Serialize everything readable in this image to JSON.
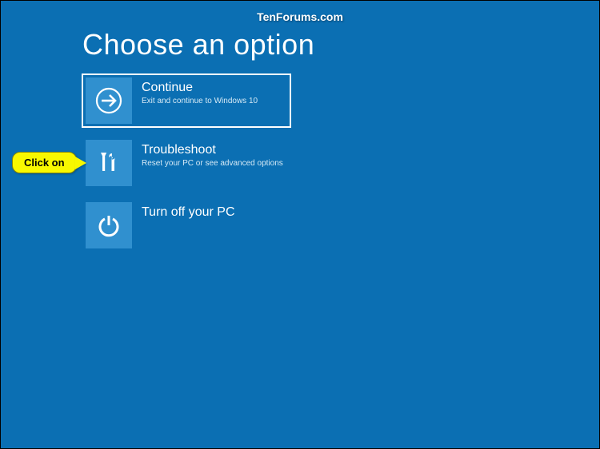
{
  "watermark": "TenForums.com",
  "title": "Choose an option",
  "options": [
    {
      "title": "Continue",
      "desc": "Exit and continue to Windows 10"
    },
    {
      "title": "Troubleshoot",
      "desc": "Reset your PC or see advanced options"
    },
    {
      "title": "Turn off your PC",
      "desc": ""
    }
  ],
  "callout": "Click on"
}
